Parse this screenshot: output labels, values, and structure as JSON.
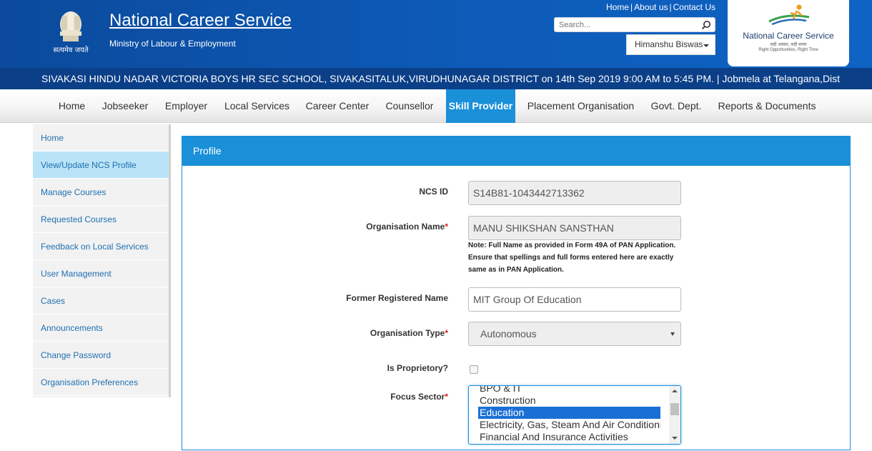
{
  "header": {
    "emblem_caption": "सत्यमेव जयते",
    "title": "National Career Service",
    "subtitle": "Ministry of Labour & Employment",
    "top_links": [
      "Home",
      "About us",
      "Contact Us"
    ],
    "search_placeholder": "Search...",
    "user_name": "Himanshu Biswas",
    "logo": {
      "title": "National Career Service",
      "sub1": "सही अवसर, सही समय",
      "sub2": "Right Opportunities, Right Time"
    }
  },
  "ticker": {
    "text": "SIVAKASI HINDU NADAR VICTORIA BOYS HR SEC SCHOOL, SIVAKASITALUK,VIRUDHUNAGAR DISTRICT on 14th Sep 2019 9:00 AM to 5:45 PM.   |   Jobmela at Telangana,Dist"
  },
  "nav": {
    "items": [
      "Home",
      "Jobseeker",
      "Employer",
      "Local Services",
      "Career Center",
      "Counsellor",
      "Skill Provider",
      "Placement Organisation",
      "Govt. Dept.",
      "Reports & Documents"
    ],
    "active": "Skill Provider"
  },
  "sidebar": {
    "items": [
      "Home",
      "View/Update NCS Profile",
      "Manage Courses",
      "Requested Courses",
      "Feedback on Local Services",
      "User Management",
      "Cases",
      "Announcements",
      "Change Password",
      "Organisation Preferences"
    ],
    "active": "View/Update NCS Profile"
  },
  "profile": {
    "heading": "Profile",
    "ncs_id": {
      "label": "NCS ID",
      "value": "S14B81-1043442713362"
    },
    "org_name": {
      "label": "Organisation Name",
      "value": "MANU SHIKSHAN SANSTHAN",
      "note_lines": [
        "Note: Full Name as provided in Form 49A of PAN Application.",
        "Ensure that spellings and full forms entered here are exactly",
        "same as in PAN Application."
      ]
    },
    "former_name": {
      "label": "Former Registered Name",
      "value": "MIT Group Of Education"
    },
    "org_type": {
      "label": "Organisation Type",
      "value": "Autonomous"
    },
    "proprietory": {
      "label": "Is Proprietory?",
      "checked": false
    },
    "focus_sector": {
      "label": "Focus Sector",
      "options": [
        "BPO & IT",
        "Construction",
        "Education",
        "Electricity, Gas, Steam And Air Conditioning",
        "Financial And Insurance Activities"
      ],
      "selected": "Education"
    },
    "required_mark": "*"
  },
  "colors": {
    "header_blue": "#0d5bb8",
    "ticker_blue": "#0b3f88",
    "accent": "#1a90d9",
    "sidebar_active": "#b9e3f7",
    "link": "#1f6fb0",
    "required": "#e02020"
  }
}
